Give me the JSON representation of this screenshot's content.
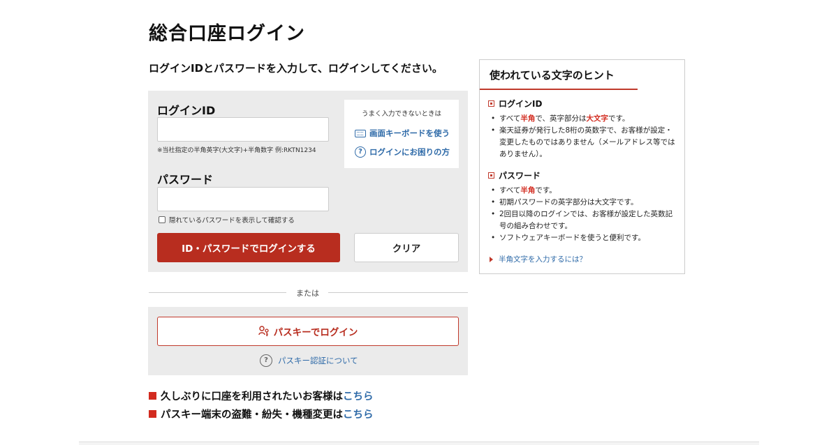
{
  "page": {
    "title": "総合口座ログイン",
    "instruction": "ログインIDとパスワードを入力して、ログインしてください。"
  },
  "login_form": {
    "id_label": "ログインID",
    "id_value": "",
    "id_note": "※当社指定の半角英字(大文字)+半角数字 例:RKTN1234",
    "password_label": "パスワード",
    "password_value": "",
    "show_password_label": "隠れているパスワードを表示して確認する",
    "login_button": "ID・パスワードでログインする",
    "clear_button": "クリア"
  },
  "help_box": {
    "title": "うまく入力できないときは",
    "keyboard_link": "画面キーボードを使う",
    "trouble_link": "ログインにお困りの方"
  },
  "divider_text": "または",
  "passkey": {
    "button": "パスキーでログイン",
    "about_link": "パスキー認証について"
  },
  "notices": [
    {
      "text": "久しぶりに口座を利用されたいお客様は",
      "link": "こちら"
    },
    {
      "text": "パスキー端末の盗難・紛失・機種変更は",
      "link": "こちら"
    }
  ],
  "hints": {
    "title": "使われている文字のヒント",
    "id_section": {
      "heading": "ログインID",
      "item1_a": "すべて",
      "item1_b": "半角",
      "item1_c": "で、英字部分は",
      "item1_d": "大文字",
      "item1_e": "です。",
      "item2": "楽天証券が発行した8桁の英数字で、お客様が設定・変更したものではありません（メールアドレス等ではありません）。"
    },
    "password_section": {
      "heading": "パスワード",
      "item1_a": "すべて",
      "item1_b": "半角",
      "item1_c": "です。",
      "item2": "初期パスワードの英字部分は大文字です。",
      "item3": "2回目以降のログインでは、お客様が設定した英数記号の組み合わせです。",
      "item4": "ソフトウェアキーボードを使うと便利です。"
    },
    "link": "半角文字を入力するには？"
  },
  "colors": {
    "accent_red": "#b82d1f",
    "link_blue": "#2e6aa8",
    "panel_gray": "#ebebeb"
  }
}
